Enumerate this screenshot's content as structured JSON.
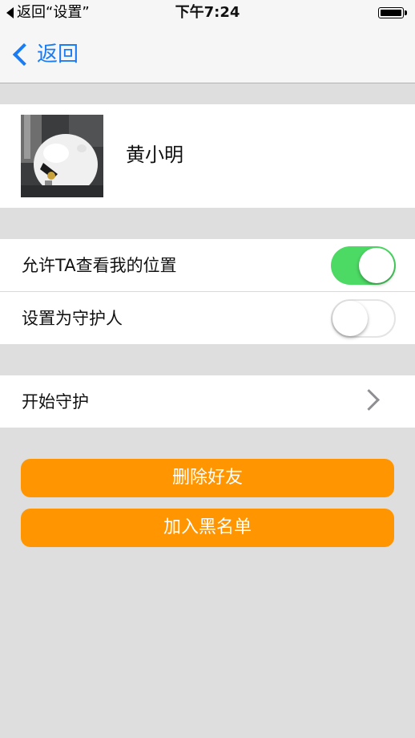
{
  "status_bar": {
    "back_text": "返回“设置”",
    "time": "下午7:24"
  },
  "nav": {
    "back_label": "返回",
    "back_icon": "chevron-left-icon"
  },
  "profile": {
    "name": "黄小明"
  },
  "settings": {
    "rows": [
      {
        "label": "允许TA查看我的位置",
        "toggle": true
      },
      {
        "label": "设置为守护人",
        "toggle": false
      }
    ]
  },
  "guard": {
    "label": "开始守护"
  },
  "buttons": {
    "delete_label": "删除好友",
    "block_label": "加入黑名单"
  },
  "colors": {
    "accent": "#1a7cf5",
    "toggle_on": "#4cd964",
    "button": "#ff9500",
    "background": "#dedede"
  }
}
